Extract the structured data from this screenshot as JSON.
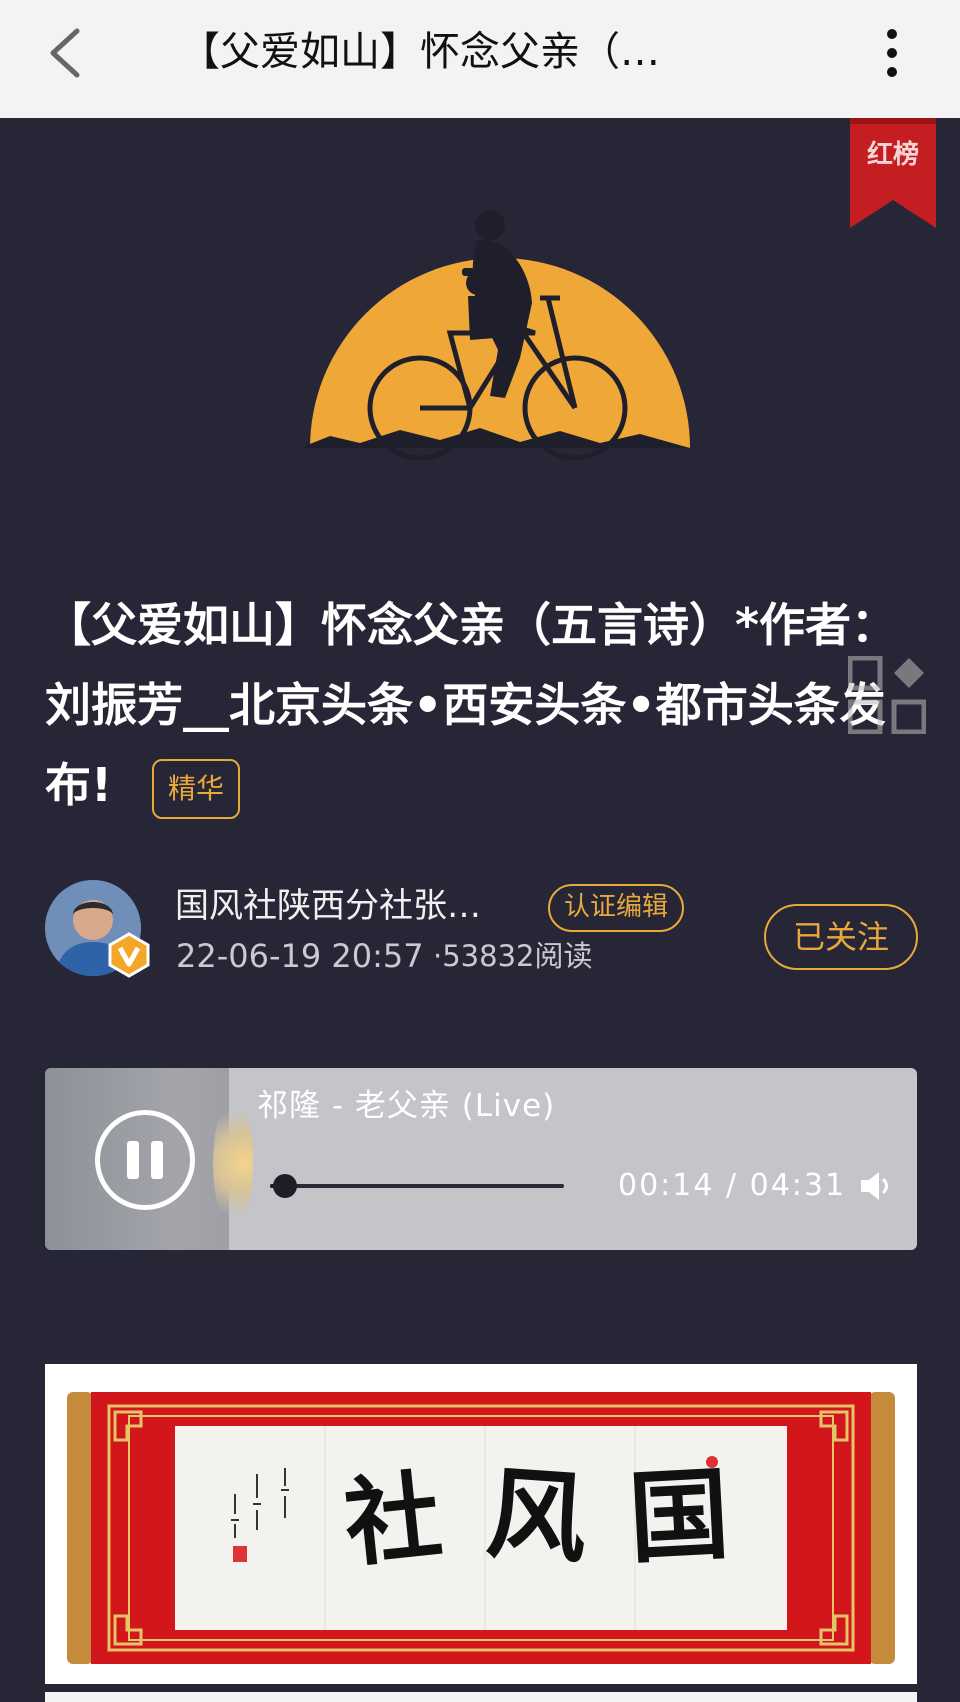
{
  "nav": {
    "title": "【父爱如山】怀念父亲（…"
  },
  "badge": {
    "ribbon_text": "红榜"
  },
  "article": {
    "title": "【父爱如山】怀念父亲（五言诗）*作者：刘振芳__北京头条•西安头条•都市头条发布!",
    "tag": "精华"
  },
  "author": {
    "name": "国风社陕西分社张…",
    "verify_tag": "认证编辑",
    "time": "22-06-19 20:57",
    "reads": "·53832阅读",
    "follow_label": "已关注"
  },
  "player": {
    "song": "祁隆 - 老父亲 (Live)",
    "time": "00:14 / 04:31",
    "progress": 0.052,
    "state": "playing"
  },
  "calligraphy": {
    "characters": [
      "社",
      "风",
      "国"
    ]
  },
  "colors": {
    "background": "#262637",
    "accent": "#e8a93a",
    "moon": "#efa838",
    "ribbon": "#c41e23",
    "scroll_red": "#d3161b"
  },
  "icons": {
    "back": "chevron-left-icon",
    "more": "more-vertical-icon",
    "pause": "pause-icon",
    "volume": "speaker-icon"
  }
}
